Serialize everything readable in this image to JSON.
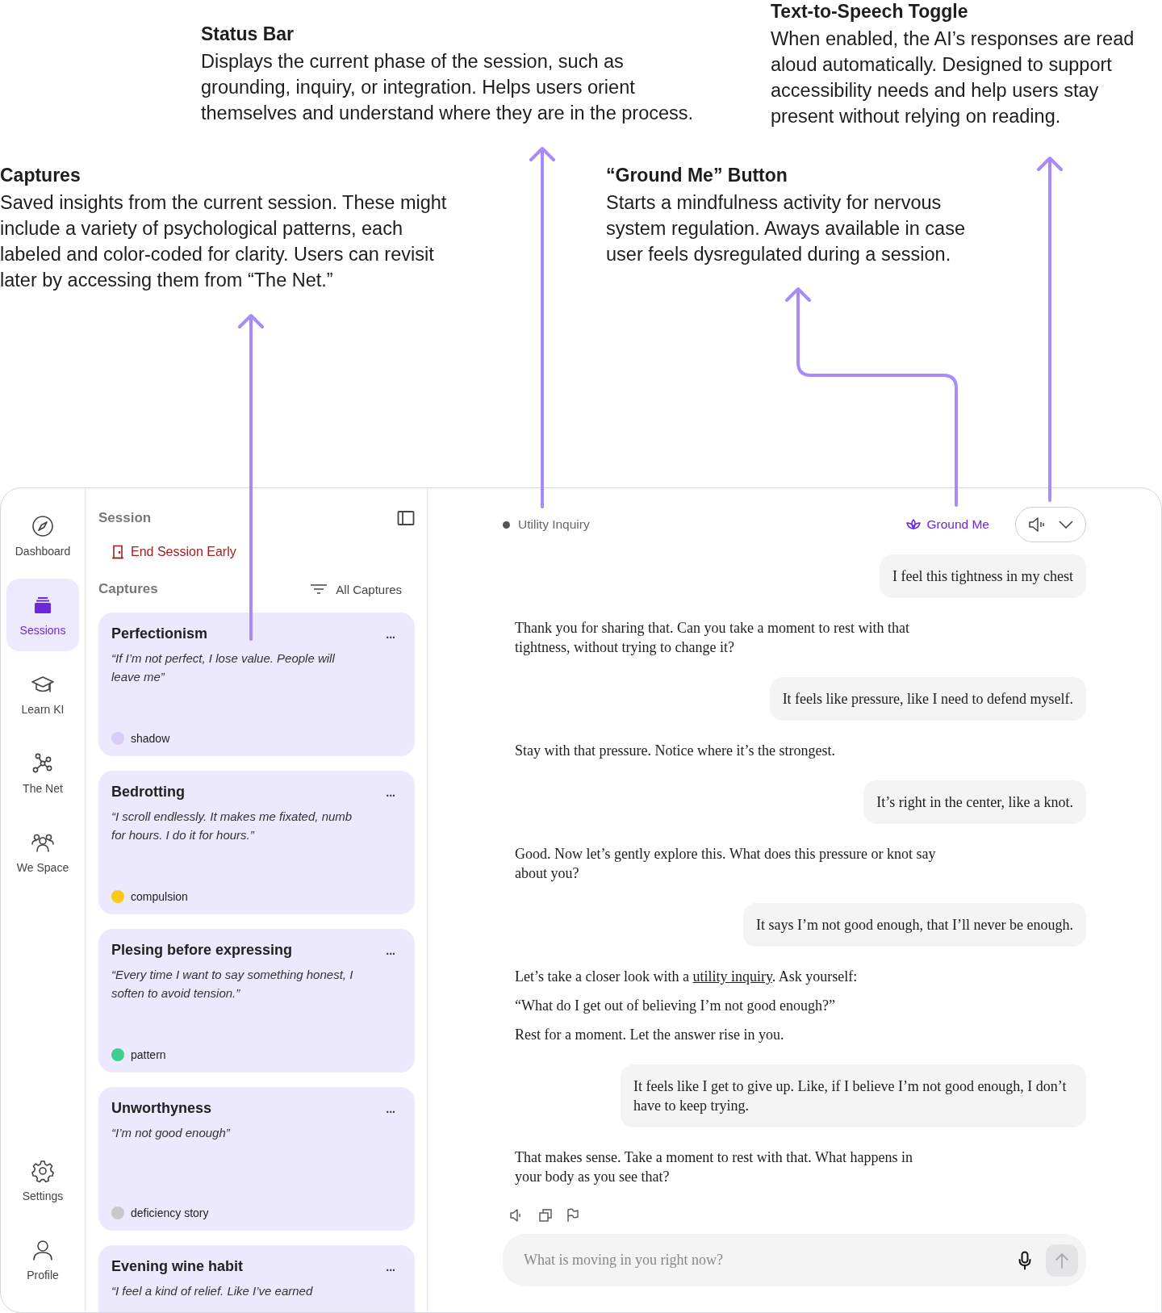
{
  "annotations": [
    {
      "title": "Status Bar",
      "body": "Displays the current phase of the session, such as grounding, inquiry, or integration. Helps users orient themselves and understand where they are in the process."
    },
    {
      "title": "Text-to-Speech Toggle",
      "body": "When enabled, the AI’s responses are read aloud automatically. Designed to support accessibility needs and help users stay present without relying on reading."
    },
    {
      "title": "Captures",
      "body": "Saved insights from the current session. These might include a variety of psychological patterns, each labeled and color-coded for clarity. Users can revisit later by accessing them from “The Net.”"
    },
    {
      "title": "“Ground Me” Button",
      "body": "Starts a mindfulness activity for nervous system regulation. Aways available in case user feels dysregulated during a session."
    }
  ],
  "sidebar": {
    "items": [
      {
        "label": "Dashboard",
        "selected": false
      },
      {
        "label": "Sessions",
        "selected": true
      },
      {
        "label": "Learn KI",
        "selected": false
      },
      {
        "label": "The Net",
        "selected": false
      },
      {
        "label": "We Space",
        "selected": false
      }
    ],
    "bottom_items": [
      {
        "label": "Settings",
        "selected": false
      },
      {
        "label": "Profile",
        "selected": false
      }
    ]
  },
  "session_panel": {
    "title": "Session",
    "end_button": "End Session Early",
    "captures_title": "Captures",
    "filter": "All Captures",
    "captures": [
      {
        "title": "Perfectionism",
        "quote": "“If I’m not perfect, I lose value. People will leave me”",
        "tag": "shadow",
        "color": "#d9cdf8",
        "menu": "..."
      },
      {
        "title": "Bedrotting",
        "quote": "“I scroll endlessly. It makes me fixated, numb for hours. I do it for hours.”",
        "tag": "compulsion",
        "color": "#f9c91c",
        "menu": "..."
      },
      {
        "title": "Plesing before expressing",
        "quote": "“Every time I want to say something honest, I soften to avoid tension.”",
        "tag": "pattern",
        "color": "#3ccf91",
        "menu": "..."
      },
      {
        "title": "Unworthyness",
        "quote": "“I’m not good enough”",
        "tag": "deficiency story",
        "color": "#c8c8cc",
        "menu": "..."
      },
      {
        "title": "Evening wine habit",
        "quote": "“I feel a kind of relief. Like I’ve earned",
        "menu": "..."
      }
    ]
  },
  "chat": {
    "status": "Utility Inquiry",
    "ground_button": "Ground Me",
    "speech_toggle": {
      "on": false
    },
    "messages": [
      {
        "from_user": true,
        "text": "I feel this tightness in my chest"
      },
      {
        "from_user": false,
        "paragraphs": [
          [
            {
              "text": "Thank you for sharing that. Can you take a moment to rest with that tightness, without trying to change it?"
            }
          ]
        ]
      },
      {
        "from_user": true,
        "text": "It feels like pressure, like I need to defend myself."
      },
      {
        "from_user": false,
        "paragraphs": [
          [
            {
              "text": "Stay with that pressure. Notice where it’s the strongest."
            }
          ]
        ]
      },
      {
        "from_user": true,
        "text": "It’s right in the center, like a knot."
      },
      {
        "from_user": false,
        "paragraphs": [
          [
            {
              "text": "Good. Now let’s gently explore this. What does this pressure or knot say about you?"
            }
          ]
        ]
      },
      {
        "from_user": true,
        "text": "It says I’m not good enough, that I’ll never be enough."
      },
      {
        "from_user": false,
        "paragraphs": [
          [
            {
              "text": "Let’s take a closer look with a "
            },
            {
              "link": "utility inquiry"
            },
            {
              "text": ". Ask yourself:"
            }
          ],
          [
            {
              "text": "“What do I get out of believing I’m not good enough?”"
            }
          ],
          [
            {
              "text": "Rest for a moment. Let the answer rise in you."
            }
          ]
        ]
      },
      {
        "from_user": true,
        "text": "It feels like I get to give up. Like, if I believe I’m not good enough, I don’t have to keep trying."
      },
      {
        "from_user": false,
        "paragraphs": [
          [
            {
              "text": "That makes sense. Take a moment to rest with that. What happens in your body as you see that?"
            }
          ]
        ]
      }
    ],
    "input": {
      "placeholder": "What is moving in you right now?"
    }
  }
}
